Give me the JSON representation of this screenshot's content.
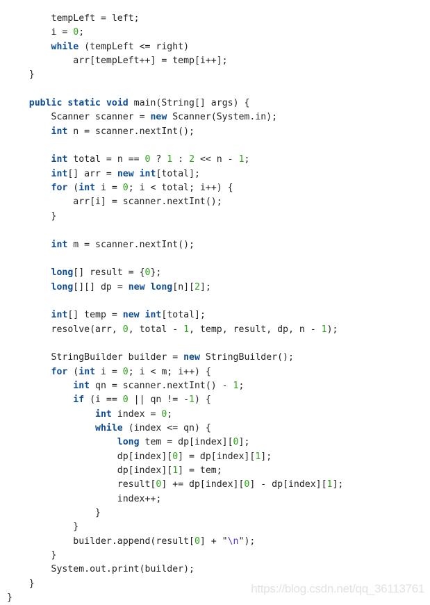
{
  "code": {
    "language": "java",
    "lines": [
      {
        "indent": 2,
        "tokens": [
          [
            "t",
            "tempLeft = left;"
          ]
        ]
      },
      {
        "indent": 2,
        "tokens": [
          [
            "t",
            "i = "
          ],
          [
            "n",
            "0"
          ],
          [
            "t",
            ";"
          ]
        ]
      },
      {
        "indent": 2,
        "tokens": [
          [
            "k",
            "while"
          ],
          [
            "t",
            " (tempLeft <= right)"
          ]
        ]
      },
      {
        "indent": 3,
        "tokens": [
          [
            "t",
            "arr[tempLeft++] = temp[i++];"
          ]
        ]
      },
      {
        "indent": 1,
        "tokens": [
          [
            "t",
            "}"
          ]
        ]
      },
      {
        "indent": 0,
        "tokens": []
      },
      {
        "indent": 1,
        "tokens": [
          [
            "k",
            "public"
          ],
          [
            "t",
            " "
          ],
          [
            "k",
            "static"
          ],
          [
            "t",
            " "
          ],
          [
            "k",
            "void"
          ],
          [
            "t",
            " main(String[] args) {"
          ]
        ]
      },
      {
        "indent": 2,
        "tokens": [
          [
            "t",
            "Scanner scanner = "
          ],
          [
            "k",
            "new"
          ],
          [
            "t",
            " Scanner(System.in);"
          ]
        ]
      },
      {
        "indent": 2,
        "tokens": [
          [
            "k",
            "int"
          ],
          [
            "t",
            " n = scanner.nextInt();"
          ]
        ]
      },
      {
        "indent": 0,
        "tokens": []
      },
      {
        "indent": 2,
        "tokens": [
          [
            "k",
            "int"
          ],
          [
            "t",
            " total = n == "
          ],
          [
            "n",
            "0"
          ],
          [
            "t",
            " ? "
          ],
          [
            "n",
            "1"
          ],
          [
            "t",
            " : "
          ],
          [
            "n",
            "2"
          ],
          [
            "t",
            " << n - "
          ],
          [
            "n",
            "1"
          ],
          [
            "t",
            ";"
          ]
        ]
      },
      {
        "indent": 2,
        "tokens": [
          [
            "k",
            "int"
          ],
          [
            "t",
            "[] arr = "
          ],
          [
            "k",
            "new"
          ],
          [
            "t",
            " "
          ],
          [
            "k",
            "int"
          ],
          [
            "t",
            "[total];"
          ]
        ]
      },
      {
        "indent": 2,
        "tokens": [
          [
            "k",
            "for"
          ],
          [
            "t",
            " ("
          ],
          [
            "k",
            "int"
          ],
          [
            "t",
            " i = "
          ],
          [
            "n",
            "0"
          ],
          [
            "t",
            "; i < total; i++) {"
          ]
        ]
      },
      {
        "indent": 3,
        "tokens": [
          [
            "t",
            "arr[i] = scanner.nextInt();"
          ]
        ]
      },
      {
        "indent": 2,
        "tokens": [
          [
            "t",
            "}"
          ]
        ]
      },
      {
        "indent": 0,
        "tokens": []
      },
      {
        "indent": 2,
        "tokens": [
          [
            "k",
            "int"
          ],
          [
            "t",
            " m = scanner.nextInt();"
          ]
        ]
      },
      {
        "indent": 0,
        "tokens": []
      },
      {
        "indent": 2,
        "tokens": [
          [
            "k",
            "long"
          ],
          [
            "t",
            "[] result = {"
          ],
          [
            "n",
            "0"
          ],
          [
            "t",
            "};"
          ]
        ]
      },
      {
        "indent": 2,
        "tokens": [
          [
            "k",
            "long"
          ],
          [
            "t",
            "[][] dp = "
          ],
          [
            "k",
            "new"
          ],
          [
            "t",
            " "
          ],
          [
            "k",
            "long"
          ],
          [
            "t",
            "[n]["
          ],
          [
            "n",
            "2"
          ],
          [
            "t",
            "];"
          ]
        ]
      },
      {
        "indent": 0,
        "tokens": []
      },
      {
        "indent": 2,
        "tokens": [
          [
            "k",
            "int"
          ],
          [
            "t",
            "[] temp = "
          ],
          [
            "k",
            "new"
          ],
          [
            "t",
            " "
          ],
          [
            "k",
            "int"
          ],
          [
            "t",
            "[total];"
          ]
        ]
      },
      {
        "indent": 2,
        "tokens": [
          [
            "t",
            "resolve(arr, "
          ],
          [
            "n",
            "0"
          ],
          [
            "t",
            ", total - "
          ],
          [
            "n",
            "1"
          ],
          [
            "t",
            ", temp, result, dp, n - "
          ],
          [
            "n",
            "1"
          ],
          [
            "t",
            ");"
          ]
        ]
      },
      {
        "indent": 0,
        "tokens": []
      },
      {
        "indent": 2,
        "tokens": [
          [
            "t",
            "StringBuilder builder = "
          ],
          [
            "k",
            "new"
          ],
          [
            "t",
            " StringBuilder();"
          ]
        ]
      },
      {
        "indent": 2,
        "tokens": [
          [
            "k",
            "for"
          ],
          [
            "t",
            " ("
          ],
          [
            "k",
            "int"
          ],
          [
            "t",
            " i = "
          ],
          [
            "n",
            "0"
          ],
          [
            "t",
            "; i < m; i++) {"
          ]
        ]
      },
      {
        "indent": 3,
        "tokens": [
          [
            "k",
            "int"
          ],
          [
            "t",
            " qn = scanner.nextInt() - "
          ],
          [
            "n",
            "1"
          ],
          [
            "t",
            ";"
          ]
        ]
      },
      {
        "indent": 3,
        "tokens": [
          [
            "k",
            "if"
          ],
          [
            "t",
            " (i == "
          ],
          [
            "n",
            "0"
          ],
          [
            "t",
            " || qn != -"
          ],
          [
            "n",
            "1"
          ],
          [
            "t",
            ") {"
          ]
        ]
      },
      {
        "indent": 4,
        "tokens": [
          [
            "k",
            "int"
          ],
          [
            "t",
            " index = "
          ],
          [
            "n",
            "0"
          ],
          [
            "t",
            ";"
          ]
        ]
      },
      {
        "indent": 4,
        "tokens": [
          [
            "k",
            "while"
          ],
          [
            "t",
            " (index <= qn) {"
          ]
        ]
      },
      {
        "indent": 5,
        "tokens": [
          [
            "k",
            "long"
          ],
          [
            "t",
            " tem = dp[index]["
          ],
          [
            "n",
            "0"
          ],
          [
            "t",
            "];"
          ]
        ]
      },
      {
        "indent": 5,
        "tokens": [
          [
            "t",
            "dp[index]["
          ],
          [
            "n",
            "0"
          ],
          [
            "t",
            "] = dp[index]["
          ],
          [
            "n",
            "1"
          ],
          [
            "t",
            "];"
          ]
        ]
      },
      {
        "indent": 5,
        "tokens": [
          [
            "t",
            "dp[index]["
          ],
          [
            "n",
            "1"
          ],
          [
            "t",
            "] = tem;"
          ]
        ]
      },
      {
        "indent": 5,
        "tokens": [
          [
            "t",
            "result["
          ],
          [
            "n",
            "0"
          ],
          [
            "t",
            "] += dp[index]["
          ],
          [
            "n",
            "0"
          ],
          [
            "t",
            "] - dp[index]["
          ],
          [
            "n",
            "1"
          ],
          [
            "t",
            "];"
          ]
        ]
      },
      {
        "indent": 5,
        "tokens": [
          [
            "t",
            "index++;"
          ]
        ]
      },
      {
        "indent": 4,
        "tokens": [
          [
            "t",
            "}"
          ]
        ]
      },
      {
        "indent": 3,
        "tokens": [
          [
            "t",
            "}"
          ]
        ]
      },
      {
        "indent": 3,
        "tokens": [
          [
            "t",
            "builder.append(result["
          ],
          [
            "n",
            "0"
          ],
          [
            "t",
            "] + \""
          ],
          [
            "e",
            "\\n"
          ],
          [
            "t",
            "\");"
          ]
        ]
      },
      {
        "indent": 2,
        "tokens": [
          [
            "t",
            "}"
          ]
        ]
      },
      {
        "indent": 2,
        "tokens": [
          [
            "t",
            "System.out.print(builder);"
          ]
        ]
      },
      {
        "indent": 1,
        "tokens": [
          [
            "t",
            "}"
          ]
        ]
      },
      {
        "indent": 0,
        "tokens": [
          [
            "t",
            "}"
          ]
        ]
      }
    ]
  },
  "watermark": "https://blog.csdn.net/qq_36113761"
}
